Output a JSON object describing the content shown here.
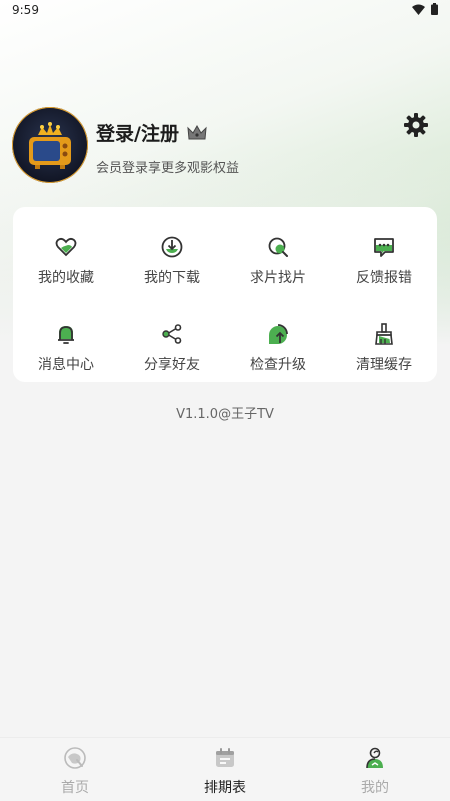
{
  "status_bar": {
    "time": "9:59"
  },
  "profile": {
    "title": "登录/注册",
    "subtitle": "会员登录享更多观影权益"
  },
  "menu": {
    "items": [
      {
        "label": "我的收藏",
        "icon": "heart-icon"
      },
      {
        "label": "我的下载",
        "icon": "download-icon"
      },
      {
        "label": "求片找片",
        "icon": "search-icon"
      },
      {
        "label": "反馈报错",
        "icon": "feedback-icon"
      },
      {
        "label": "消息中心",
        "icon": "bell-icon"
      },
      {
        "label": "分享好友",
        "icon": "share-icon"
      },
      {
        "label": "检查升级",
        "icon": "upgrade-icon"
      },
      {
        "label": "清理缓存",
        "icon": "broom-icon"
      }
    ]
  },
  "version": "V1.1.0@王子TV",
  "tabbar": {
    "tabs": [
      {
        "label": "首页",
        "icon": "home-icon"
      },
      {
        "label": "排期表",
        "icon": "calendar-icon"
      },
      {
        "label": "我的",
        "icon": "profile-icon"
      }
    ]
  },
  "colors": {
    "accent": "#4caf50",
    "icon_dark": "#333333"
  }
}
